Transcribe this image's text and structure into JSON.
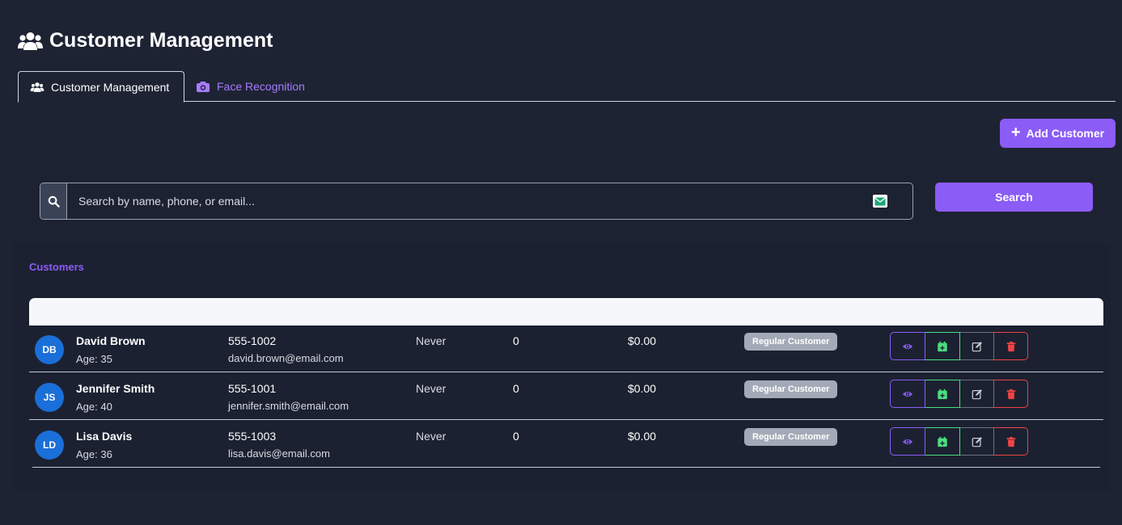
{
  "header": {
    "title": "Customer Management",
    "icon": "users-icon"
  },
  "tabs": [
    {
      "label": "Customer Management",
      "icon": "users-icon",
      "active": true
    },
    {
      "label": "Face Recognition",
      "icon": "camera-icon",
      "active": false
    }
  ],
  "toolbar": {
    "add_customer_label": "Add Customer"
  },
  "search": {
    "placeholder": "Search by name, phone, or email...",
    "value": "",
    "button_label": "Search"
  },
  "customers_section": {
    "title": "Customers"
  },
  "customers": [
    {
      "initials": "DB",
      "name": "David Brown",
      "age": "Age: 35",
      "phone": "555-1002",
      "email": "david.brown@email.com",
      "last_visit": "Never",
      "visits": "0",
      "spent": "$0.00",
      "type": "Regular Customer"
    },
    {
      "initials": "JS",
      "name": "Jennifer Smith",
      "age": "Age: 40",
      "phone": "555-1001",
      "email": "jennifer.smith@email.com",
      "last_visit": "Never",
      "visits": "0",
      "spent": "$0.00",
      "type": "Regular Customer"
    },
    {
      "initials": "LD",
      "name": "Lisa Davis",
      "age": "Age: 36",
      "phone": "555-1003",
      "email": "lisa.davis@email.com",
      "last_visit": "Never",
      "visits": "0",
      "spent": "$0.00",
      "type": "Regular Customer"
    }
  ],
  "colors": {
    "background": "#1e2334",
    "accent": "#8b5cf6",
    "avatar": "#1a6fd9",
    "badge": "#a3a9b6",
    "success": "#4ade80",
    "danger": "#ef4444"
  }
}
